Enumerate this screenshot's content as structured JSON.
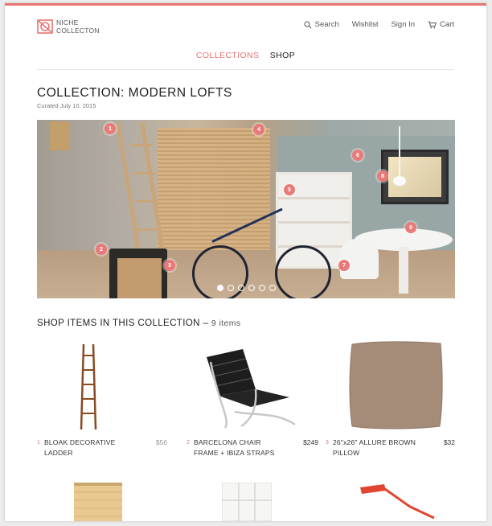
{
  "brand": {
    "logo_line1": "NICHE",
    "logo_line2": "COLLECTON",
    "accent_color": "#e87474"
  },
  "util_nav": {
    "search": "Search",
    "wishlist": "Wishlist",
    "signin": "Sign In",
    "cart": "Cart"
  },
  "main_nav": {
    "collections": "COLLECTIONS",
    "shop": "SHOP"
  },
  "collection": {
    "title": "COLLECTION: MODERN LOFTS",
    "curated": "Curated July 10, 2015"
  },
  "hero": {
    "pins": [
      "1",
      "2",
      "3",
      "4",
      "5",
      "6",
      "7",
      "8",
      "9"
    ],
    "carousel": {
      "total_slides": 6,
      "active_slide": 1
    }
  },
  "shop": {
    "heading": "SHOP ITEMS IN THIS COLLECTION",
    "separator": " – ",
    "count": "9 items"
  },
  "products": [
    {
      "num": "1",
      "name": "BLOAK DECORATIVE LADDER",
      "price": "$56"
    },
    {
      "num": "2",
      "name": "BARCELONA CHAIR FRAME + IBIZA STRAPS",
      "price": "$249"
    },
    {
      "num": "3",
      "name": "26\"x26\" ALLURE BROWN PILLOW",
      "price": "$32"
    }
  ]
}
